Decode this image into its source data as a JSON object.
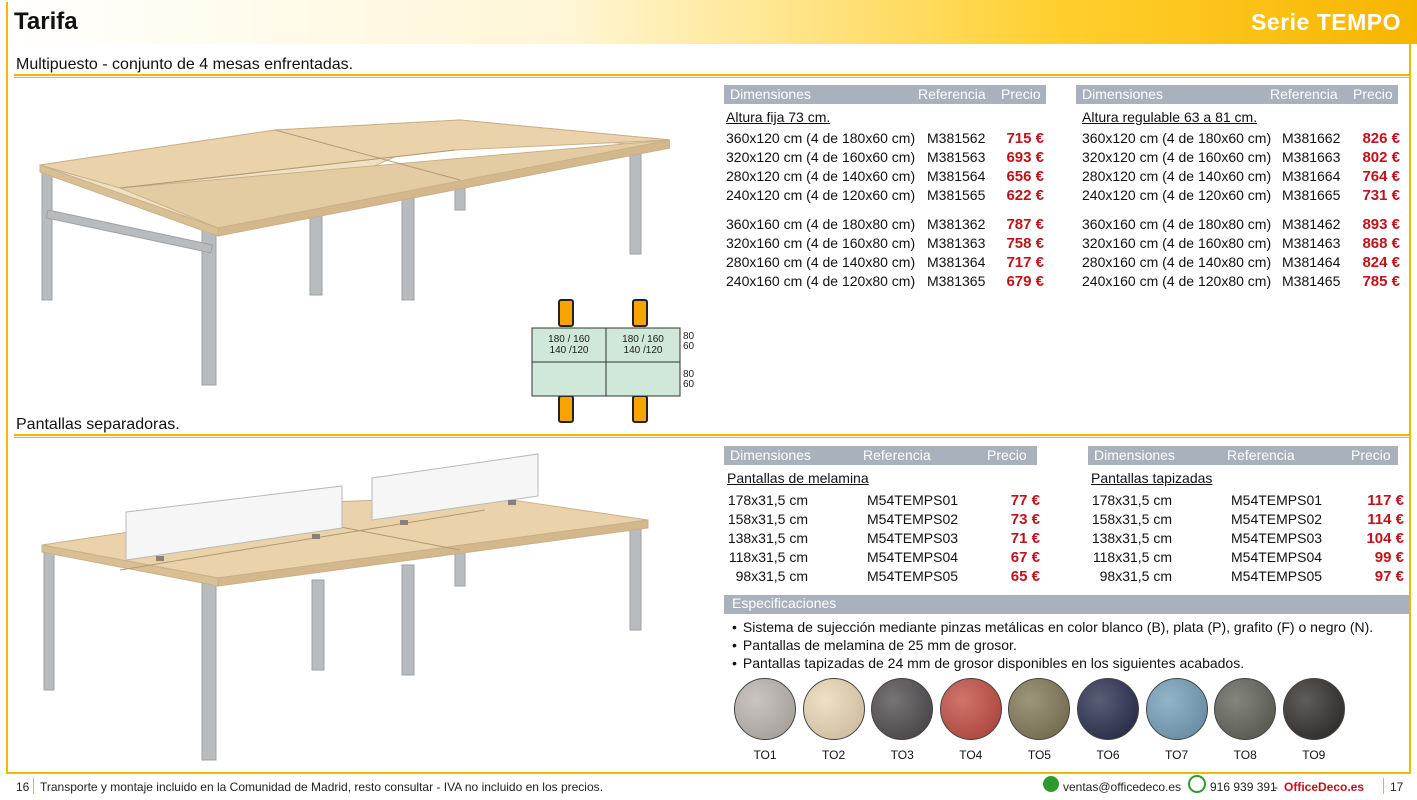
{
  "header": {
    "title": "Tarifa",
    "serie": "Serie TEMPO"
  },
  "section1": {
    "title": "Multipuesto - conjunto de 4 mesas enfrentadas.",
    "scheme": {
      "cell_line1": "180 / 160",
      "cell_line2": "140 /120",
      "side_top_a": "80",
      "side_top_b": "60",
      "side_bottom_a": "80",
      "side_bottom_b": "60"
    },
    "table_fixed": {
      "headers": {
        "dim": "Dimensiones",
        "ref": "Referencia",
        "price": "Precio"
      },
      "subtitle": "Altura fija 73 cm.",
      "rows": [
        {
          "dim": "360x120 cm (4 de 180x60 cm)",
          "ref": "M381562",
          "price": "715 €"
        },
        {
          "dim": "320x120 cm (4 de 160x60 cm)",
          "ref": "M381563",
          "price": "693 €"
        },
        {
          "dim": "280x120 cm (4 de 140x60 cm)",
          "ref": "M381564",
          "price": "656 €"
        },
        {
          "dim": "240x120 cm (4 de 120x60 cm)",
          "ref": "M381565",
          "price": "622 €"
        },
        {
          "dim": "360x160 cm (4 de 180x80 cm)",
          "ref": "M381362",
          "price": "787 €"
        },
        {
          "dim": "320x160 cm (4 de 160x80 cm)",
          "ref": "M381363",
          "price": "758 €"
        },
        {
          "dim": "280x160 cm (4 de 140x80 cm)",
          "ref": "M381364",
          "price": "717 €"
        },
        {
          "dim": "240x160 cm (4 de 120x80 cm)",
          "ref": "M381365",
          "price": "679 €"
        }
      ]
    },
    "table_adjustable": {
      "headers": {
        "dim": "Dimensiones",
        "ref": "Referencia",
        "price": "Precio"
      },
      "subtitle": "Altura regulable 63 a 81 cm.",
      "rows": [
        {
          "dim": "360x120 cm (4 de 180x60 cm)",
          "ref": "M381662",
          "price": "826 €"
        },
        {
          "dim": "320x120 cm (4 de 160x60 cm)",
          "ref": "M381663",
          "price": "802 €"
        },
        {
          "dim": "280x120 cm (4 de 140x60 cm)",
          "ref": "M381664",
          "price": "764 €"
        },
        {
          "dim": "240x120 cm (4 de 120x60 cm)",
          "ref": "M381665",
          "price": "731 €"
        },
        {
          "dim": "360x160 cm (4 de 180x80 cm)",
          "ref": "M381462",
          "price": "893 €"
        },
        {
          "dim": "320x160 cm (4 de 160x80 cm)",
          "ref": "M381463",
          "price": "868 €"
        },
        {
          "dim": "280x160 cm (4 de 140x80 cm)",
          "ref": "M381464",
          "price": "824 €"
        },
        {
          "dim": "240x160 cm (4 de 120x80 cm)",
          "ref": "M381465",
          "price": "785 €"
        }
      ]
    }
  },
  "section2": {
    "title": "Pantallas separadoras.",
    "table_melamine": {
      "headers": {
        "dim": "Dimensiones",
        "ref": "Referencia",
        "price": "Precio"
      },
      "subtitle": "Pantallas de melamina",
      "rows": [
        {
          "dim": "178x31,5 cm",
          "ref": "M54TEMPS01",
          "price": "77 €"
        },
        {
          "dim": "158x31,5 cm",
          "ref": "M54TEMPS02",
          "price": "73 €"
        },
        {
          "dim": "138x31,5 cm",
          "ref": "M54TEMPS03",
          "price": "71 €"
        },
        {
          "dim": "118x31,5 cm",
          "ref": "M54TEMPS04",
          "price": "67 €"
        },
        {
          "dim": "98x31,5 cm",
          "ref": "M54TEMPS05",
          "price": "65 €"
        }
      ]
    },
    "table_upholstered": {
      "headers": {
        "dim": "Dimensiones",
        "ref": "Referencia",
        "price": "Precio"
      },
      "subtitle": "Pantallas tapizadas",
      "rows": [
        {
          "dim": "178x31,5 cm",
          "ref": "M54TEMPS01",
          "price": "117 €"
        },
        {
          "dim": "158x31,5 cm",
          "ref": "M54TEMPS02",
          "price": "114 €"
        },
        {
          "dim": "138x31,5 cm",
          "ref": "M54TEMPS03",
          "price": "104 €"
        },
        {
          "dim": "118x31,5 cm",
          "ref": "M54TEMPS04",
          "price": "99 €"
        },
        {
          "dim": "98x31,5 cm",
          "ref": "M54TEMPS05",
          "price": "97 €"
        }
      ]
    },
    "specs": {
      "title": "Especificaciones",
      "items": [
        "Sistema de sujección mediante pinzas metálicas en color blanco (B), plata (P), grafito (F) o negro (N).",
        "Pantallas de melamina de 25 mm de grosor.",
        "Pantallas tapizadas de 24 mm de grosor disponibles en los siguientes acabados."
      ]
    },
    "swatches": [
      {
        "label": "TO1",
        "color": "#b8b2ab"
      },
      {
        "label": "TO2",
        "color": "#e9d5b3"
      },
      {
        "label": "TO3",
        "color": "#4b4548"
      },
      {
        "label": "TO4",
        "color": "#c0463c"
      },
      {
        "label": "TO5",
        "color": "#7d7350"
      },
      {
        "label": "TO6",
        "color": "#232748"
      },
      {
        "label": "TO7",
        "color": "#6f9bb4"
      },
      {
        "label": "TO8",
        "color": "#5b5d52"
      },
      {
        "label": "TO9",
        "color": "#2a2624"
      }
    ]
  },
  "footer": {
    "page_left": "16",
    "note": "Transporte y montaje incluido en la Comunidad de Madrid, resto consultar - IVA no incluido en los precios.",
    "email": "ventas@officedeco.es",
    "phone": "916 939 391",
    "separator": "-",
    "brand": "OfficeDeco.es",
    "page_right": "17"
  },
  "colors": {
    "accent": "#f5b800",
    "price": "#c0121b",
    "table_header": "#a8b1bc",
    "wood": "#e8d3ae",
    "frame_metal": "#b9bcbf"
  }
}
